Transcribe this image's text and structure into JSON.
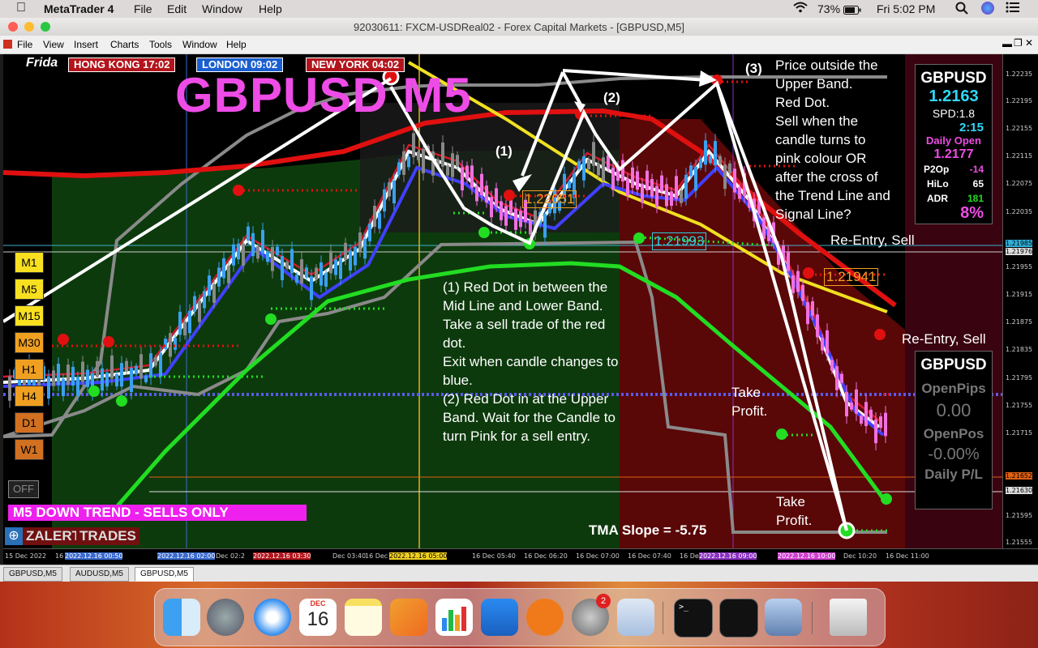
{
  "macos_menubar": {
    "app_name": "MetaTrader 4",
    "menus": [
      "File",
      "Edit",
      "Window",
      "Help"
    ],
    "battery": "73%",
    "clock": "Fri 5:02 PM"
  },
  "window": {
    "title": "92030611: FXCM-USDReal02 - Forex Capital Markets - [GBPUSD,M5]"
  },
  "app_menu": [
    "File",
    "View",
    "Insert",
    "Charts",
    "Tools",
    "Window",
    "Help"
  ],
  "chart": {
    "symbol_title": "GBPUSD M5",
    "day_label": "Frida",
    "sessions": [
      {
        "label": "HONG KONG 17:02",
        "color": "#b3141c"
      },
      {
        "label": "LONDON   09:02",
        "color": "#1a5fd0"
      },
      {
        "label": "NEW YORK  04:02",
        "color": "#b3141c"
      }
    ],
    "timeframes": [
      "M1",
      "M5",
      "M15",
      "M30",
      "H1",
      "H4",
      "D1",
      "W1"
    ],
    "off_button": "OFF",
    "trend_banner": "M5  DOWN TREND - SELLS ONLY",
    "zalert_button": "ZALERT",
    "trades_button": "TRADES",
    "tma_slope": "TMA Slope = -5.75",
    "markers": {
      "m1": "(1)",
      "m2": "(2)",
      "m3": "(3)"
    },
    "price_tags": {
      "p1": "1.22051",
      "p2": "1.21993",
      "p3": "1.21941"
    },
    "annotation_left": [
      "(1) Red Dot in between the",
      "Mid Line and Lower Band.",
      "Take a sell trade of the red",
      "dot.",
      "Exit when candle changes to",
      "blue.",
      "(2) Red Dot in at the Upper",
      "Band. Wait for the Candle to",
      "turn Pink for a sell entry."
    ],
    "annotation_top": [
      "Price outside the",
      "Upper Band.",
      "Red Dot.",
      "Sell when the",
      "candle turns  to",
      "pink colour OR",
      "after the cross of",
      "the Trend Line and",
      "Signal Line?"
    ],
    "reentry_1": "Re-Entry, Sell",
    "reentry_2": "Re-Entry, Sell",
    "take_profit_1": [
      "Take",
      "Profit."
    ],
    "take_profit_2": [
      "Take",
      "Profit."
    ]
  },
  "info_panel": {
    "symbol": "GBPUSD",
    "price": "1.2163",
    "spread": "SPD:1.8",
    "timer": "2:15",
    "daily_open_label": "Daily Open",
    "daily_open": "1.2177",
    "p2o_label": "P2Op",
    "p2o": "-14",
    "hilo_label": "HiLo",
    "hilo": "65",
    "adr_label": "ADR",
    "adr": "181",
    "percent": "8%"
  },
  "pips_panel": {
    "symbol": "GBPUSD",
    "open_pips_label": "OpenPips",
    "open_pips": "0.00",
    "open_pos_label": "OpenPos",
    "open_pos": "-0.00%",
    "daily_pl_label": "Daily P/L"
  },
  "price_axis": [
    "1.22235",
    "1.22195",
    "1.22155",
    "1.22115",
    "1.22075",
    "1.22035",
    "1.21985",
    "1.21976",
    "1.21955",
    "1.21915",
    "1.21875",
    "1.21835",
    "1.21795",
    "1.21755",
    "1.21715",
    "1.21652",
    "1.21630",
    "1.21595",
    "1.21555"
  ],
  "time_axis": [
    "15 Dec 2022",
    "16 Dec 01:00",
    "2022.12.16 00:50",
    "2022.12.16 02:00",
    "Dec 02:2",
    "2022.12.16 03:30",
    "Dec 03:40",
    "16 Dec 04:20",
    "2022.12.16 05:00",
    "16 Dec 05:40",
    "16 Dec 06:20",
    "16 Dec 07:00",
    "16 Dec 07:40",
    "16 Dec 08:20",
    "2022.12.16 09:00",
    "2022.12.16 10:00",
    "Dec 10:20",
    "16 Dec 11:00"
  ],
  "chart_tabs": [
    "GBPUSD,M5",
    "AUDUSD,M5",
    "GBPUSD,M5"
  ],
  "dock": {
    "calendar_month": "DEC",
    "calendar_day": "16",
    "badge": "2"
  },
  "colors": {
    "upper_band": "#e01010",
    "lower_band": "#22dd22",
    "trend_line": "#f0e020",
    "mid_line": "#2244ff",
    "bull_candle": "#3aa0f0",
    "bear_candle": "#f070e0",
    "title_magenta": "#ee4ce6"
  }
}
